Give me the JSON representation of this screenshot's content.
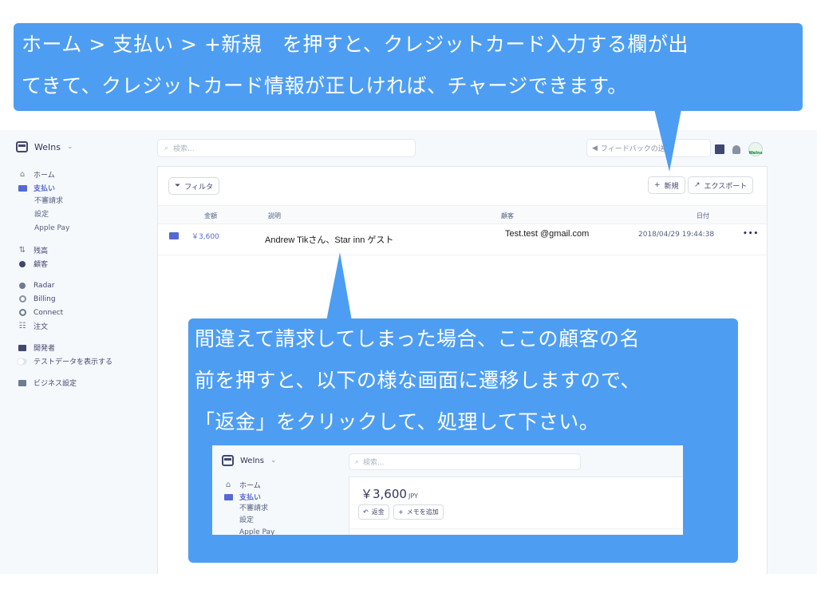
{
  "callout_top": {
    "line1": "ホーム > 支払い > +新規　を押すと、クレジットカード入力する欄が出",
    "line2": "てきて、クレジットカード情報が正しければ、チャージできます。"
  },
  "callout_mid": {
    "line1": "間違えて請求してしまった場合、ここの顧客の名",
    "line2": "前を押すと、以下の様な画面に遷移しますので、",
    "line3": "「返金」をクリックして、処理して下さい。"
  },
  "app": {
    "account_name": "WeIns",
    "search_placeholder": "検索...",
    "feedback_label": "フィードバックの送信",
    "avatar_text": "WeIns"
  },
  "sidebar": {
    "home": "ホーム",
    "payments": "支払い",
    "payments_sub": [
      "不審請求",
      "設定",
      "Apple Pay"
    ],
    "balance": "残高",
    "customers": "顧客",
    "radar": "Radar",
    "billing": "Billing",
    "connect": "Connect",
    "orders": "注文",
    "developers": "開発者",
    "test_data": "テストデータを表示する",
    "business_settings": "ビジネス設定"
  },
  "toolbar": {
    "filter": "フィルタ",
    "new": "新規",
    "export": "エクスポート"
  },
  "table": {
    "headers": {
      "amount": "金額",
      "description": "説明",
      "customer": "顧客",
      "date": "日付"
    },
    "rows": [
      {
        "amount": "￥3,600",
        "description": "Andrew Tikさん、Star inn ゲスト",
        "customer": "Test.test @gmail.com",
        "date": "2018/04/29 19:44:38",
        "more": "•••"
      }
    ]
  },
  "inset": {
    "account_name": "WeIns",
    "search_placeholder": "検索...",
    "nav": [
      "ホーム",
      "支払い",
      "不審請求",
      "設定",
      "Apple Pay"
    ],
    "amount": "￥3,600",
    "currency": "JPY",
    "refund_button": "返金",
    "memo_button": "メモを追加"
  },
  "colors": {
    "callout": "#4d9ef2",
    "accent": "#5469d4"
  }
}
